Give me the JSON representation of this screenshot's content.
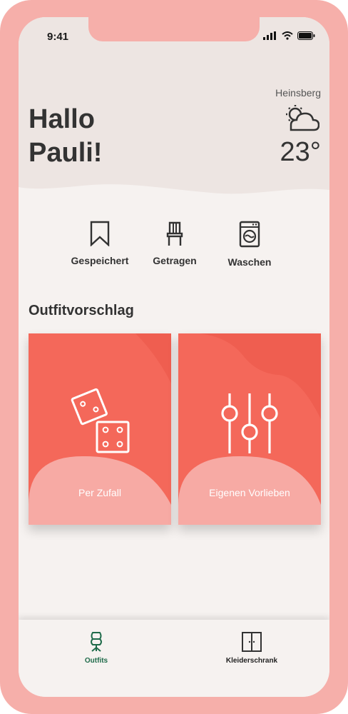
{
  "status_bar": {
    "time": "9:41"
  },
  "header": {
    "greeting": "Hallo\nPauli!",
    "city": "Heinsberg",
    "temperature": "23°",
    "weather_icon": "partly-cloudy-icon"
  },
  "quick_actions": [
    {
      "label": "Gespeichert",
      "icon": "bookmark-icon"
    },
    {
      "label": "Getragen",
      "icon": "chair-icon"
    },
    {
      "label": "Waschen",
      "icon": "washing-machine-icon"
    }
  ],
  "section_title": "Outfitvorschlag",
  "cards": [
    {
      "label": "Per Zufall",
      "icon": "dice-icon"
    },
    {
      "label": "Eigenen Vorlieben",
      "icon": "sliders-icon"
    }
  ],
  "tabbar": {
    "items": [
      {
        "label": "Outfits",
        "icon": "mannequin-icon",
        "active": true
      },
      {
        "label": "Kleiderschrank",
        "icon": "wardrobe-icon",
        "active": false
      }
    ]
  },
  "colors": {
    "frame": "#f6afaa",
    "background": "#f6f2f0",
    "header": "#ede5e2",
    "card": "#f4685a",
    "card_blob": "#f7aaa4",
    "active_tab": "#1f6b4a"
  }
}
